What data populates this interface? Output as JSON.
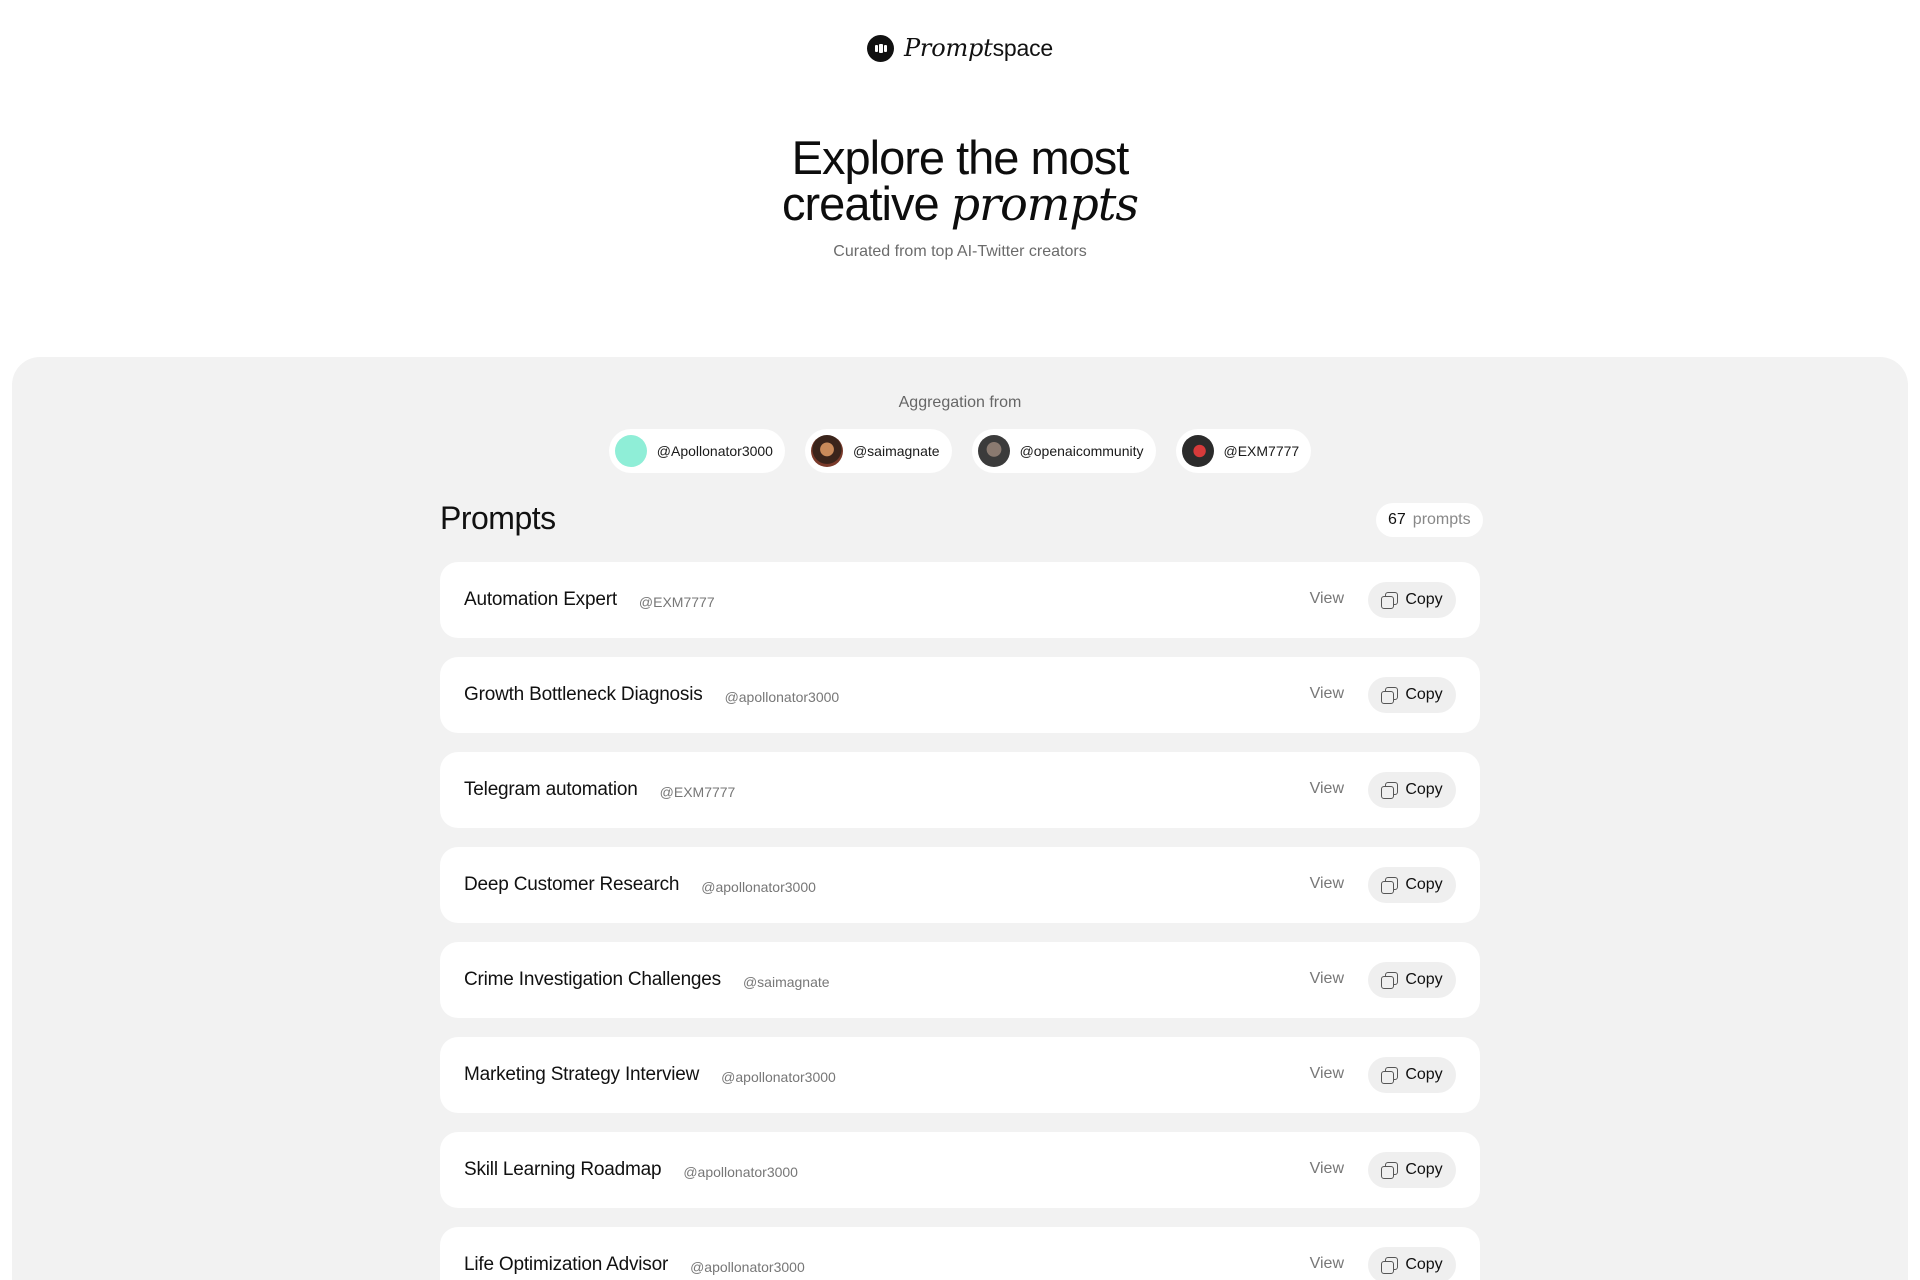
{
  "brand": {
    "italic": "Prompt",
    "rest": "space"
  },
  "hero": {
    "line1": "Explore the most",
    "line2_plain": "creative",
    "line2_italic": "prompts",
    "subtitle": "Curated from top AI-Twitter creators"
  },
  "aggregation": {
    "label": "Aggregation from",
    "sources": [
      {
        "handle": "@Apollonator3000",
        "avatar": "mint-circle"
      },
      {
        "handle": "@saimagnate",
        "avatar": "photo"
      },
      {
        "handle": "@openaicommunity",
        "avatar": "photo"
      },
      {
        "handle": "@EXM7777",
        "avatar": "photo"
      }
    ]
  },
  "prompts": {
    "title": "Prompts",
    "count": "67",
    "count_unit": "prompts",
    "view_label": "View",
    "copy_label": "Copy",
    "items": [
      {
        "name": "Automation Expert",
        "author": "@EXM7777"
      },
      {
        "name": "Growth Bottleneck Diagnosis",
        "author": "@apollonator3000"
      },
      {
        "name": "Telegram automation",
        "author": "@EXM7777"
      },
      {
        "name": "Deep Customer Research",
        "author": "@apollonator3000"
      },
      {
        "name": "Crime Investigation Challenges",
        "author": "@saimagnate"
      },
      {
        "name": "Marketing Strategy Interview",
        "author": "@apollonator3000"
      },
      {
        "name": "Skill Learning Roadmap",
        "author": "@apollonator3000"
      },
      {
        "name": "Life Optimization Advisor",
        "author": "@apollonator3000"
      }
    ]
  }
}
